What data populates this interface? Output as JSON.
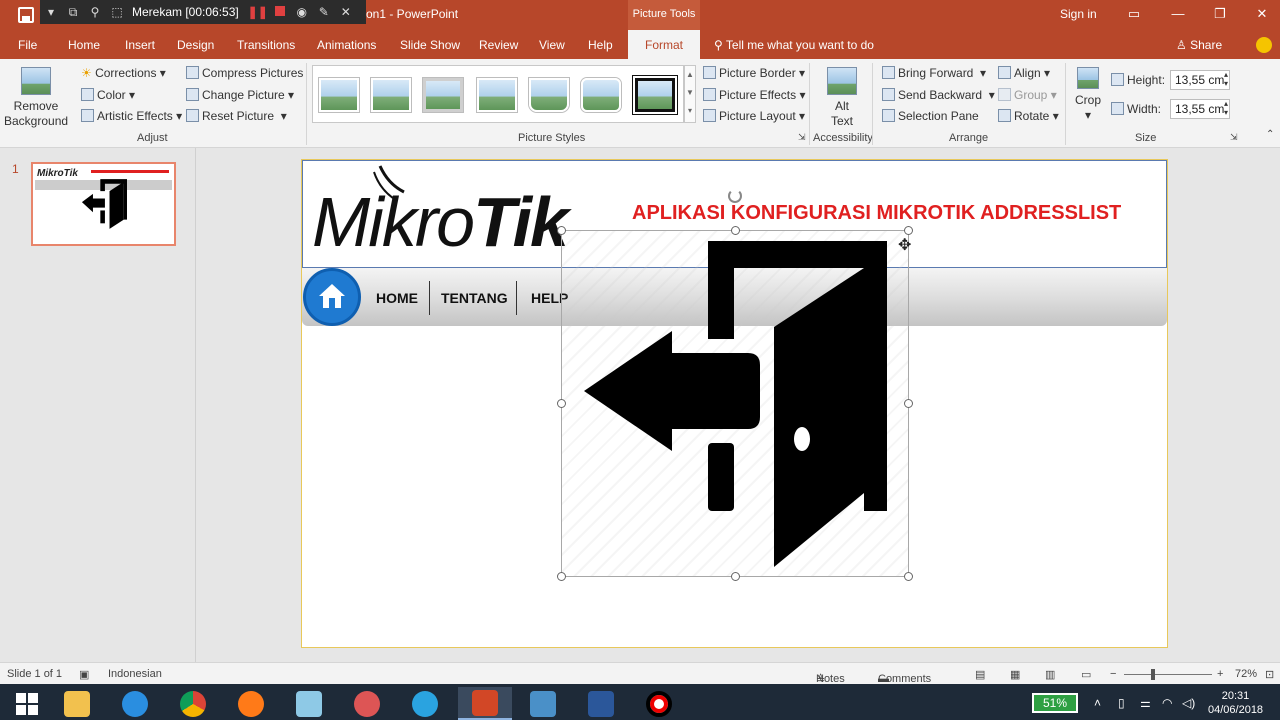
{
  "titlebar": {
    "doc_title": "on1 - PowerPoint",
    "context_label": "Picture Tools",
    "sign_in": "Sign in",
    "minimize": "—",
    "restore": "❐",
    "close": "✕"
  },
  "recorder": {
    "status": "Merekam [00:06:53]"
  },
  "tabs": {
    "file": "File",
    "home": "Home",
    "insert": "Insert",
    "design": "Design",
    "transitions": "Transitions",
    "animations": "Animations",
    "slideshow": "Slide Show",
    "review": "Review",
    "view": "View",
    "help": "Help",
    "format": "Format",
    "tellme": "Tell me what you want to do",
    "share": "Share"
  },
  "ribbon": {
    "remove_bg_line1": "Remove",
    "remove_bg_line2": "Background",
    "corrections": "Corrections",
    "color": "Color",
    "artistic": "Artistic Effects",
    "compress": "Compress Pictures",
    "change": "Change Picture",
    "reset": "Reset Picture",
    "group_adjust": "Adjust",
    "group_styles": "Picture Styles",
    "border": "Picture Border",
    "effects": "Picture Effects",
    "layout": "Picture Layout",
    "alt_line1": "Alt",
    "alt_line2": "Text",
    "group_access": "Accessibility",
    "bring": "Bring Forward",
    "send": "Send Backward",
    "selpane": "Selection Pane",
    "align": "Align",
    "group": "Group",
    "rotate": "Rotate",
    "group_arrange": "Arrange",
    "crop": "Crop",
    "height_label": "Height:",
    "height_value": "13,55 cm",
    "width_label": "Width:",
    "width_value": "13,55 cm",
    "group_size": "Size"
  },
  "slidepane": {
    "slide_number": "1"
  },
  "slide": {
    "logo_light": "Mikro",
    "logo_bold": "Tik",
    "title": "APLIKASI KONFIGURASI MIKROTIK ADDRESSLIST",
    "nav": [
      "HOME",
      "TENTANG",
      "HELP"
    ]
  },
  "status": {
    "slide_info": "Slide 1 of 1",
    "language": "Indonesian",
    "notes": "Notes",
    "comments": "Comments",
    "zoom": "72%"
  },
  "taskbar": {
    "battery": "51%",
    "time": "20:31",
    "date": "04/06/2018"
  },
  "colors": {
    "accent": "#b7472a",
    "title_red": "#e02020",
    "home_blue": "#1f7ad1"
  }
}
